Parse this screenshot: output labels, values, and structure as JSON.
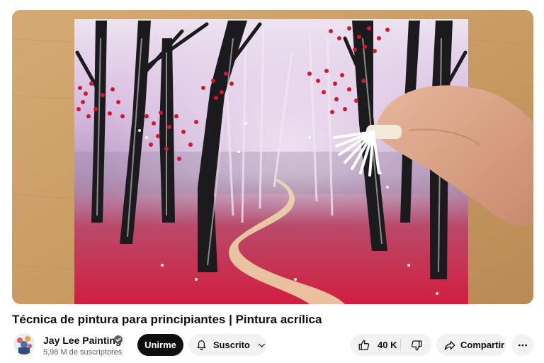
{
  "video": {
    "title": "Técnica de pintura para principiantes | Pintura acrílica",
    "thumbnail": "painting-forest-red-trees-path"
  },
  "channel": {
    "name": "Jay Lee Painting",
    "subscribers": "5,98 M de suscriptores",
    "verified_icon": "verified-check-icon",
    "avatar": "avatar"
  },
  "actions": {
    "join_label": "Unirme",
    "subscribed_label": "Suscrito",
    "like_count": "40 K",
    "share_label": "Compartir"
  },
  "colors": {
    "primary_text": "#0f0f0f",
    "secondary_text": "#606060",
    "join_bg": "#0f0f0f",
    "chip_bg": "#f2f2f2"
  }
}
